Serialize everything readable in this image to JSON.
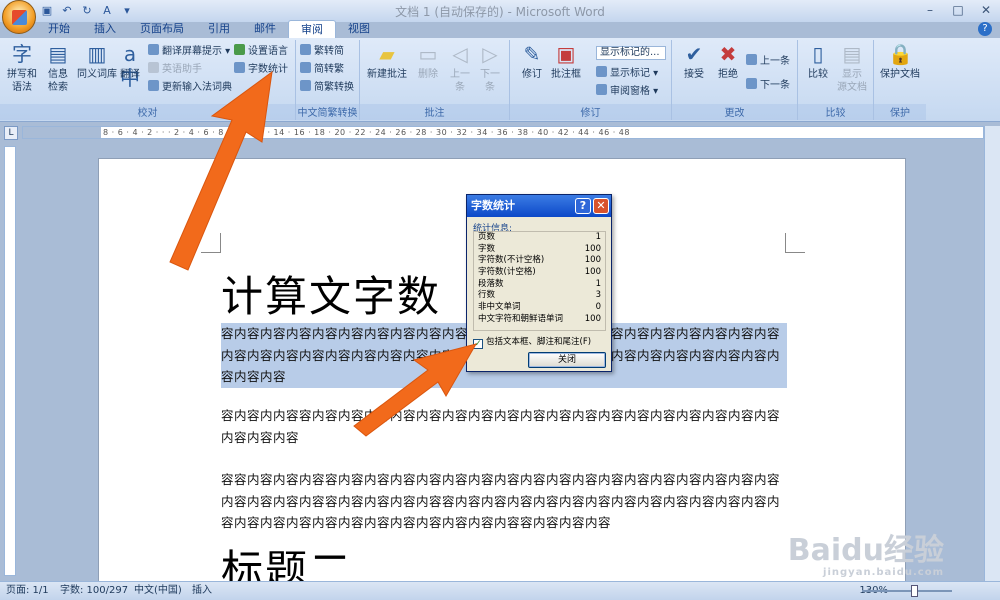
{
  "window": {
    "title": "文档 1 (自动保存的) - Microsoft Word"
  },
  "tabs": [
    "开始",
    "插入",
    "页面布局",
    "引用",
    "邮件",
    "审阅",
    "视图"
  ],
  "ribbon": {
    "proofing": {
      "label": "校对",
      "spell": "拼写和\n语法",
      "info": "信息\n检索",
      "thesaurus": "同义词库",
      "translate": "翻译",
      "translate_tip": "翻译屏幕提示",
      "english_assist": "英语助手",
      "update_ime": "更新输入法词典",
      "set_lang": "设置语言",
      "word_count": "字数统计"
    },
    "chinese": {
      "label": "中文简繁转换",
      "t2s": "繁转简",
      "s2t": "简转繁",
      "convert": "简繁转换"
    },
    "comments": {
      "label": "批注",
      "new": "新建批注",
      "delete": "删除",
      "prev": "上一\n条",
      "next": "下一\n条"
    },
    "tracking": {
      "label": "修订",
      "track": "修订",
      "balloons": "批注框",
      "show_final": "显示标记的...",
      "show_markup": "显示标记",
      "review_pane": "审阅窗格"
    },
    "changes": {
      "label": "更改",
      "accept": "接受",
      "reject": "拒绝",
      "prev": "上一条",
      "next": "下一条"
    },
    "compare": {
      "label": "比较",
      "compare": "比较",
      "show_source": "显示\n源文档"
    },
    "protect": {
      "label": "保护",
      "protect_doc": "保护文档"
    }
  },
  "ruler_text": "8 · 6 · 4 · 2 · · · 2 · 4 · 6 · 8 · 10 · 12 · 14 · 16 · 18 · 20 · 22 · 24 · 26 · 28 · 30 · 32 · 34 · 36 · 38 · 40 · 42 · 44 · 46 · 48",
  "document": {
    "heading1": "计算文字数",
    "para1": "容内容内容内容内容内容内容内容内容内容内容内容内容内容内容内容内容内容内容内容内容内容内容内容内容内容内容内容内容内容内容内容内容内容内容内容内容内容内容内容内容内容内容内容内容内容",
    "para2": "容内容内内容容内容内容内容内容内容内容内容内容内容内容内容内容内容内容内容内容内容内容内容内容内容",
    "para3": "容容内容内容内容容内容内容内容内容内容内容内容内容内容内容内容内容内容内容内容内容内容内容内容内容内容容内容内容内容内容容内容内容内容内容内容内容内容内容内容内容内容内容内容内容内容内容内容内容内容内容内容内容内容内容容内容内容内容",
    "heading2": "标题二"
  },
  "dialog": {
    "title": "字数统计",
    "section": "统计信息:",
    "rows": [
      {
        "label": "页数",
        "value": "1"
      },
      {
        "label": "字数",
        "value": "100"
      },
      {
        "label": "字符数(不计空格)",
        "value": "100"
      },
      {
        "label": "字符数(计空格)",
        "value": "100"
      },
      {
        "label": "段落数",
        "value": "1"
      },
      {
        "label": "行数",
        "value": "3"
      },
      {
        "label": "非中文单词",
        "value": "0"
      },
      {
        "label": "中文字符和朝鲜语单词",
        "value": "100"
      }
    ],
    "include_label": "包括文本框、脚注和尾注(F)",
    "close": "关闭"
  },
  "status": {
    "page": "页面: 1/1",
    "words": "字数: 100/297",
    "lang": "中文(中国)",
    "mode": "插入",
    "zoom": "130%"
  },
  "watermark": {
    "brand": "Baidu经验",
    "url": "jingyan.baidu.com"
  },
  "colors": {
    "arrow": "#f26a1b",
    "selection": "#b8cce8"
  }
}
